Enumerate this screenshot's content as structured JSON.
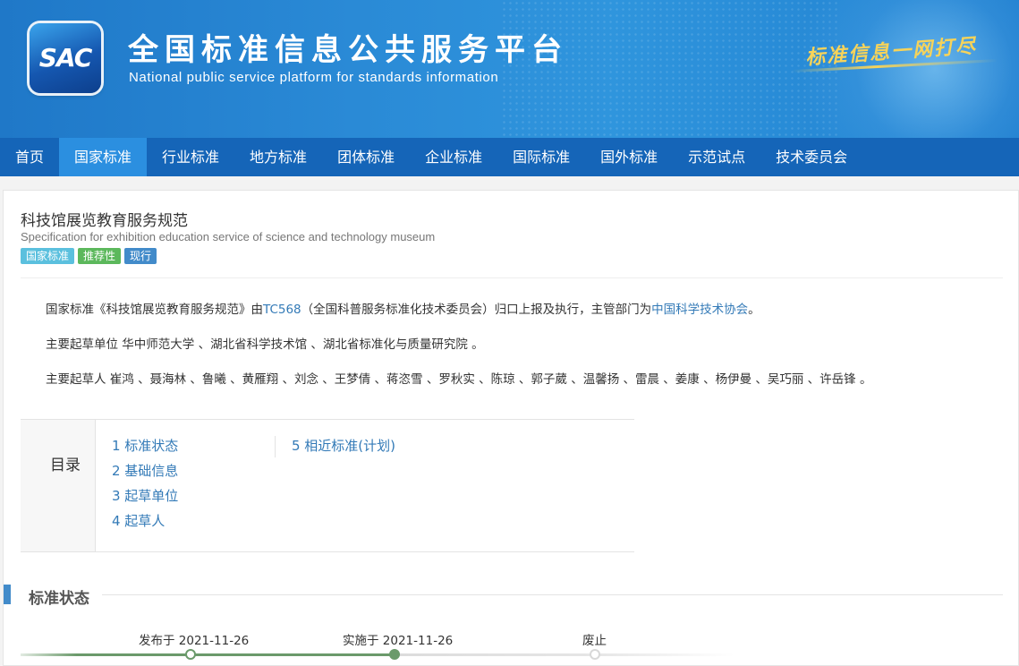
{
  "header": {
    "logo_text": "SAC",
    "title_cn": "全国标准信息公共服务平台",
    "title_en": "National public service platform  for standards information",
    "slogan": "标准信息一网打尽"
  },
  "nav": {
    "items": [
      "首页",
      "国家标准",
      "行业标准",
      "地方标准",
      "团体标准",
      "企业标准",
      "国际标准",
      "国外标准",
      "示范试点",
      "技术委员会"
    ],
    "active_index": 1
  },
  "standard": {
    "title": "科技馆展览教育服务规范",
    "subtitle": "Specification for exhibition education service of science and technology museum",
    "badges": [
      "国家标准",
      "推荐性",
      "现行"
    ]
  },
  "intro": {
    "p1_prefix": "国家标准《科技馆展览教育服务规范》由",
    "p1_tc_link": "TC568",
    "p1_middle": "（全国科普服务标准化技术委员会）归口上报及执行，主管部门为",
    "p1_dept_link": "中国科学技术协会",
    "p1_suffix": "。",
    "p2": "主要起草单位 华中师范大学 、湖北省科学技术馆 、湖北省标准化与质量研究院 。",
    "p3": "主要起草人 崔鸿 、聂海林 、鲁曦 、黄雁翔 、刘念 、王梦倩 、蒋恣雪 、罗秋实 、陈琼 、郭子葳 、温馨扬 、雷晨 、姜康 、杨伊曼 、吴巧丽 、许岳锋 。"
  },
  "toc": {
    "label": "目录",
    "items": [
      "1  标准状态",
      "2  基础信息",
      "3  起草单位",
      "4  起草人",
      "5  相近标准(计划)"
    ]
  },
  "status_section": {
    "title": "标准状态",
    "timeline": {
      "published": "发布于 2021-11-26",
      "implemented": "实施于 2021-11-26",
      "abolished": "废止"
    }
  },
  "colors": {
    "header_blue": "#1f78c8",
    "nav_blue": "#1565b8",
    "nav_active": "#2b8fe0",
    "link": "#337ab7",
    "timeline_green": "#6b9a6b"
  }
}
